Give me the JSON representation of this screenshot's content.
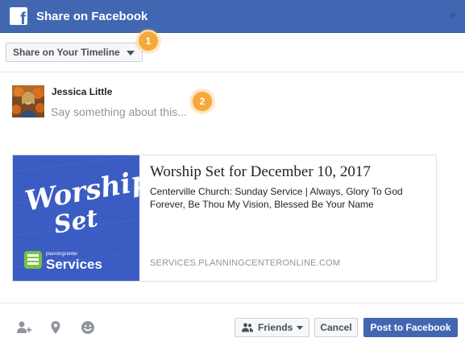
{
  "dialog": {
    "title": "Share on Facebook",
    "logo_letter": "f"
  },
  "share_target": {
    "selected": "Share on Your Timeline"
  },
  "callouts": [
    "1",
    "2"
  ],
  "composer": {
    "user_name": "Jessica Little",
    "placeholder": "Say something about this..."
  },
  "link_card": {
    "title": "Worship Set for December 10, 2017",
    "description": "Centerville Church: Sunday Service  |  Always, Glory To God Forever, Be Thou My Vision, Blessed Be Your Name",
    "domain": "SERVICES.PLANNINGCENTERONLINE.COM",
    "image": {
      "headline_line1": "Worship",
      "headline_line2": "Set",
      "brand_small": "planningcenter",
      "brand_large": "Services"
    }
  },
  "footer": {
    "icons": [
      "tag-friends-icon",
      "location-pin-icon",
      "feeling-emoji-icon"
    ],
    "audience_label": "Friends",
    "cancel_label": "Cancel",
    "post_label": "Post to Facebook"
  },
  "colors": {
    "header_blue": "#4267b2",
    "callout_orange": "#f6a93b",
    "card_image_blue": "#3b5cc2",
    "services_green": "#7ac143"
  }
}
